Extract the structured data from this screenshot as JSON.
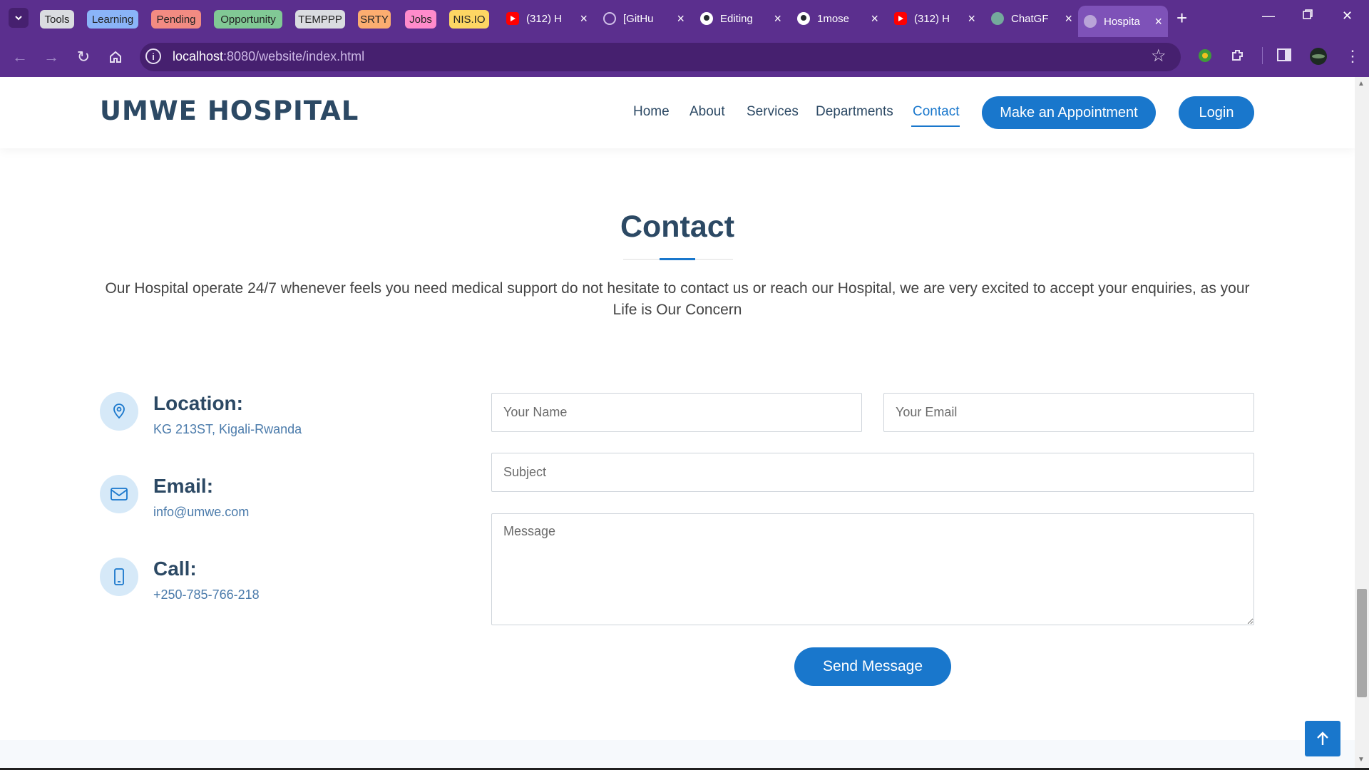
{
  "browser": {
    "tab_groups": [
      {
        "label": "Tools",
        "color": "#dadce0"
      },
      {
        "label": "Learning",
        "color": "#8ab4f8"
      },
      {
        "label": "Pending",
        "color": "#f28b82"
      },
      {
        "label": "Opportunity",
        "color": "#81c995"
      },
      {
        "label": "TEMPPP",
        "color": "#dadce0"
      },
      {
        "label": "SRTY",
        "color": "#fcad70"
      },
      {
        "label": "Jobs",
        "color": "#ff8bcb"
      },
      {
        "label": "NIS.IO",
        "color": "#fdd663"
      }
    ],
    "tabs": [
      {
        "title": "(312) H",
        "icon": "youtube-icon"
      },
      {
        "title": "[GitHu",
        "icon": "github-copilot-icon"
      },
      {
        "title": "Editing",
        "icon": "github-icon"
      },
      {
        "title": "1mose",
        "icon": "github-icon"
      },
      {
        "title": "(312) H",
        "icon": "youtube-icon"
      },
      {
        "title": "ChatGF",
        "icon": "chatgpt-icon"
      },
      {
        "title": "Hospita",
        "icon": "globe-icon",
        "active": true
      }
    ],
    "url_host": "localhost",
    "url_rest": ":8080/website/index.html",
    "theme_color": "#5b2f8e"
  },
  "site": {
    "logo": "UMWE HOSPITAL",
    "nav": [
      "Home",
      "About",
      "Services",
      "Departments",
      "Contact"
    ],
    "active_nav": "Contact",
    "appointment_button": "Make an Appointment",
    "login_button": "Login",
    "accent_color": "#1977cc",
    "heading_color": "#2c4964"
  },
  "contact": {
    "title": "Contact",
    "intro": "Our Hospital operate 24/7 whenever feels you need medical support do not hesitate to contact us or reach our Hospital, we are very excited to accept your enquiries, as your Life is Our Concern",
    "location_label": "Location:",
    "location_value": "KG 213ST, Kigali-Rwanda",
    "email_label": "Email:",
    "email_value": "info@umwe.com",
    "call_label": "Call:",
    "call_value": "+250-785-766-218",
    "form": {
      "name_placeholder": "Your Name",
      "email_placeholder": "Your Email",
      "subject_placeholder": "Subject",
      "message_placeholder": "Message",
      "send_label": "Send Message"
    }
  }
}
